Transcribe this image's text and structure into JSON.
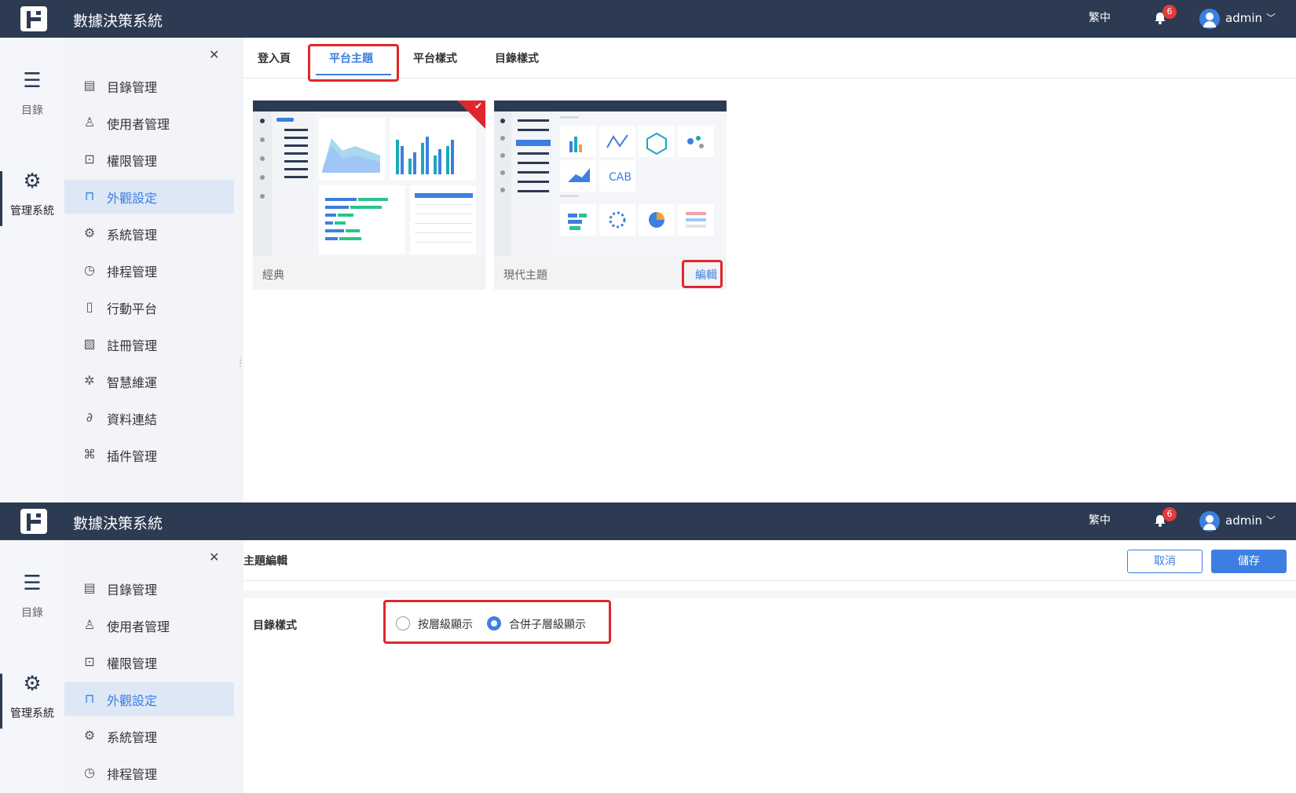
{
  "app": {
    "title": "數據決策系統",
    "language": "繁中",
    "notification_count": "6",
    "user": "admin"
  },
  "rail": {
    "items": [
      {
        "icon": "list-icon",
        "label": "目錄"
      },
      {
        "icon": "gear-icon",
        "label": "管理系統"
      }
    ]
  },
  "menu": {
    "items": [
      {
        "icon": "document-icon",
        "label": "目錄管理"
      },
      {
        "icon": "user-icon",
        "label": "使用者管理"
      },
      {
        "icon": "lock-icon",
        "label": "權限管理"
      },
      {
        "icon": "paint-roller-icon",
        "label": "外觀設定"
      },
      {
        "icon": "settings-icon",
        "label": "系統管理"
      },
      {
        "icon": "timer-icon",
        "label": "排程管理"
      },
      {
        "icon": "tablet-icon",
        "label": "行動平台"
      },
      {
        "icon": "register-icon",
        "label": "註冊管理"
      },
      {
        "icon": "network-icon",
        "label": "智慧維運"
      },
      {
        "icon": "paperclip-icon",
        "label": "資料連結"
      },
      {
        "icon": "puzzle-icon",
        "label": "插件管理"
      }
    ],
    "active": "外觀設定"
  },
  "appearance": {
    "tabs": [
      "登入頁",
      "平台主題",
      "平台樣式",
      "目錄樣式"
    ],
    "active_tab": "平台主題",
    "themes": [
      {
        "name": "經典",
        "selected": true
      },
      {
        "name": "現代主題",
        "edit_label": "編輯"
      }
    ]
  },
  "theme_edit": {
    "title": "主題編輯",
    "cancel": "取消",
    "save": "儲存",
    "field_label": "目錄樣式",
    "options": [
      "按層級顯示",
      "合併子層級顯示"
    ],
    "selected_option": "合併子層級顯示"
  },
  "colors": {
    "topbar": "#2c3a52",
    "accent": "#3d7fe0",
    "highlight": "#e0262b"
  }
}
